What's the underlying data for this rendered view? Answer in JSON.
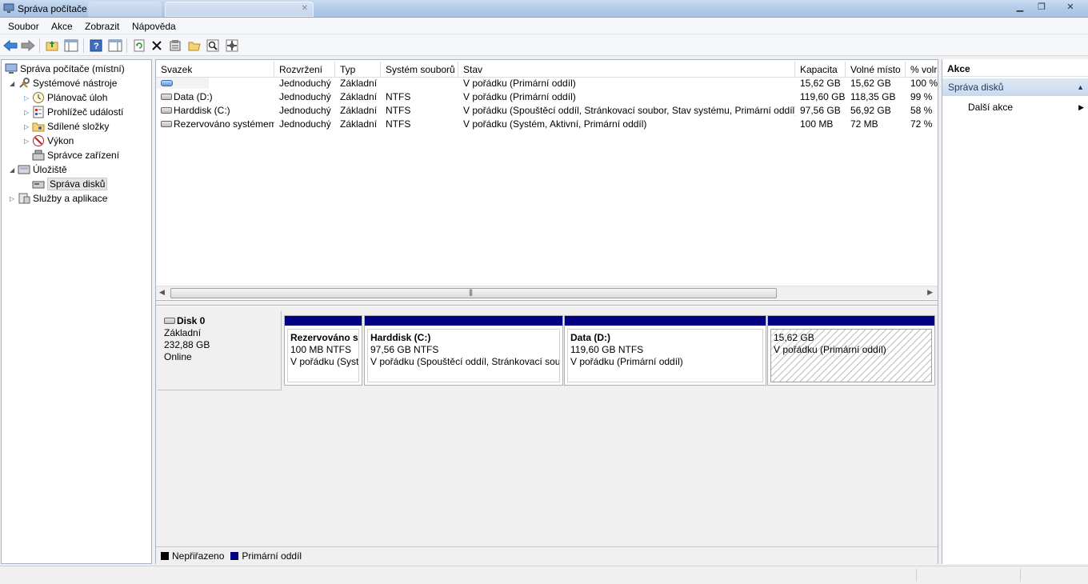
{
  "window": {
    "title": "Správa počítače"
  },
  "menu": [
    "Soubor",
    "Akce",
    "Zobrazit",
    "Nápověda"
  ],
  "toolbar": [
    "back-icon",
    "forward-icon",
    "up-folder-icon",
    "show-hide-tree-icon",
    "help-icon",
    "show-hide-action-pane-icon",
    "refresh-icon",
    "delete-icon",
    "properties-icon",
    "open-icon",
    "search-icon",
    "settings-icon"
  ],
  "tree": [
    {
      "label": "Správa počítače (místní)",
      "icon": "computer-management-icon"
    },
    {
      "label": "Systémové nástroje",
      "icon": "system-tools-icon"
    },
    {
      "label": "Plánovač úloh",
      "icon": "clock-icon"
    },
    {
      "label": "Prohlížeč událostí",
      "icon": "event-viewer-icon"
    },
    {
      "label": "Sdílené složky",
      "icon": "shared-folder-icon"
    },
    {
      "label": "Výkon",
      "icon": "performance-icon"
    },
    {
      "label": "Správce zařízení",
      "icon": "device-manager-icon"
    },
    {
      "label": "Úložiště",
      "icon": "storage-icon"
    },
    {
      "label": "Správa disků",
      "icon": "disk-management-icon"
    },
    {
      "label": "Služby a aplikace",
      "icon": "services-icon"
    }
  ],
  "volumes": {
    "columns": [
      "Svazek",
      "Rozvržení",
      "Typ",
      "Systém souborů",
      "Stav",
      "Kapacita",
      "Volné místo",
      "% volr"
    ],
    "rows": [
      [
        "",
        "Jednoduchý",
        "Základní",
        "",
        "V pořádku (Primární oddíl)",
        "15,62 GB",
        "15,62 GB",
        "100 %"
      ],
      [
        "Data (D:)",
        "Jednoduchý",
        "Základní",
        "NTFS",
        "V pořádku (Primární oddíl)",
        "119,60 GB",
        "118,35 GB",
        "99 %"
      ],
      [
        "Harddisk (C:)",
        "Jednoduchý",
        "Základní",
        "NTFS",
        "V pořádku (Spouštěcí oddíl, Stránkovací soubor, Stav systému, Primární oddíl)",
        "97,56 GB",
        "56,92 GB",
        "58 %"
      ],
      [
        "Rezervováno systémem",
        "Jednoduchý",
        "Základní",
        "NTFS",
        "V pořádku (Systém, Aktivní, Primární oddíl)",
        "100 MB",
        "72 MB",
        "72 %"
      ]
    ]
  },
  "disk": {
    "name": "Disk 0",
    "type": "Základní",
    "size": "232,88 GB",
    "status": "Online",
    "partitions": [
      {
        "name": "Rezervováno sy",
        "size": "100 MB NTFS",
        "status": "V pořádku (Syst"
      },
      {
        "name": "Harddisk  (C:)",
        "size": "97,56 GB NTFS",
        "status": "V pořádku (Spouštěcí oddíl, Stránkovací soul"
      },
      {
        "name": "Data  (D:)",
        "size": "119,60 GB NTFS",
        "status": "V pořádku (Primární oddíl)"
      },
      {
        "name": "",
        "size": "15,62 GB",
        "status": "V pořádku (Primární oddíl)"
      }
    ]
  },
  "legend": [
    {
      "label": "Nepřiřazeno",
      "color": "#000000"
    },
    {
      "label": "Primární oddíl",
      "color": "#000080"
    }
  ],
  "actions": {
    "title": "Akce",
    "section": "Správa disků",
    "item": "Další akce"
  },
  "colors": {
    "primary_partition": "#000080",
    "selection_section": "#c8d9ee"
  }
}
